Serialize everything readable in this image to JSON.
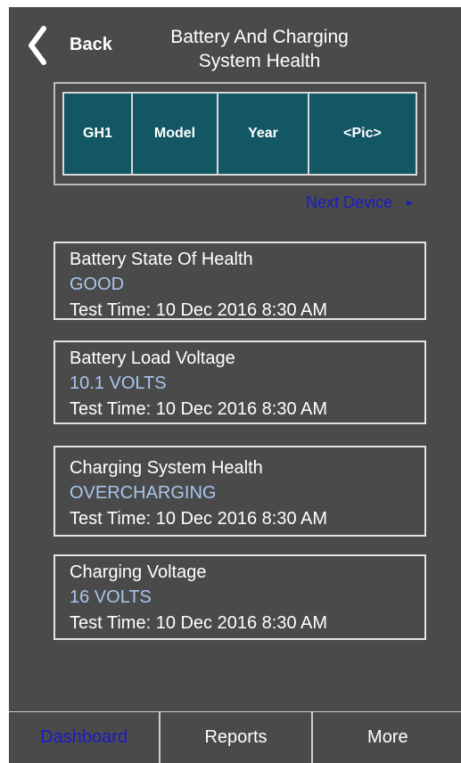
{
  "header": {
    "back_label": "Back",
    "title_line1": "Battery And Charging",
    "title_line2": "System Health"
  },
  "device": {
    "cells": [
      "GH1",
      "Model",
      "Year",
      "<Pic>"
    ],
    "next_label": "Next Device",
    "next_icon": "triangle-right-icon"
  },
  "cards": [
    {
      "label": "Battery State Of Health",
      "value": "GOOD",
      "time": "Test Time: 10 Dec 2016 8:30 AM"
    },
    {
      "label": "Battery Load Voltage",
      "value": "10.1 VOLTS",
      "time": "Test Time: 10 Dec 2016 8:30 AM"
    },
    {
      "label": "Charging System Health",
      "value": "OVERCHARGING",
      "time": "Test Time: 10 Dec 2016 8:30 AM"
    },
    {
      "label": "Charging Voltage",
      "value": "16 VOLTS",
      "time": "Test Time: 10 Dec 2016 8:30 AM"
    }
  ],
  "tabs": [
    {
      "label": "Dashboard",
      "active": true
    },
    {
      "label": "Reports",
      "active": false
    },
    {
      "label": "More",
      "active": false
    }
  ],
  "colors": {
    "background": "#4a4a4a",
    "tile": "#125763",
    "value_text": "#a9c5ec",
    "link": "#1a1acc"
  }
}
